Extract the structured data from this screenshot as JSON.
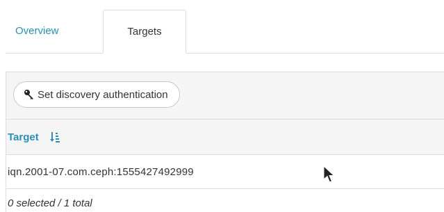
{
  "tabs": [
    {
      "label": "Overview",
      "active": false
    },
    {
      "label": "Targets",
      "active": true
    }
  ],
  "toolbar": {
    "discovery_button_label": "Set discovery authentication",
    "discovery_icon": "key-icon"
  },
  "table": {
    "columns": [
      {
        "label": "Target",
        "sort_icon": "sort-ascending-icon"
      }
    ],
    "rows": [
      {
        "target": "iqn.2001-07.com.ceph:1555427492999"
      }
    ],
    "footer": "0 selected / 1 total"
  },
  "colors": {
    "accent": "#2b8fb8",
    "text": "#333333",
    "border": "#dddddd",
    "toolbar_bg": "#f5f5f5"
  }
}
